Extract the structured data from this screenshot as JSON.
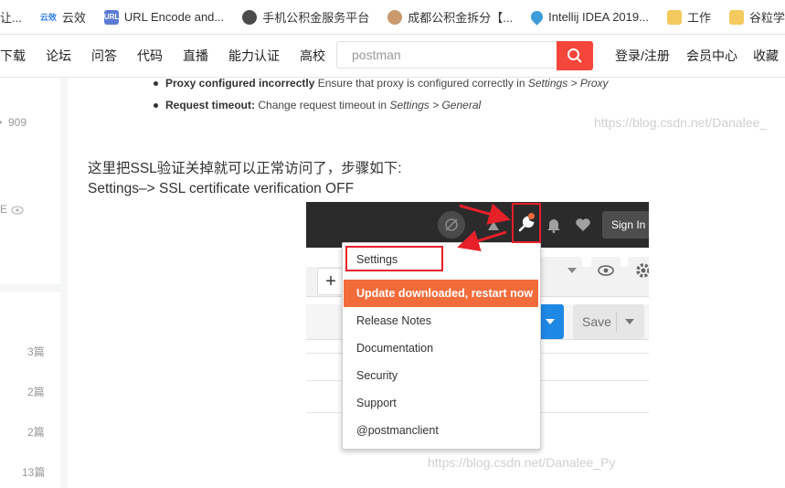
{
  "bookmarks": [
    {
      "label": "让...",
      "icon": "none"
    },
    {
      "label": "云效",
      "icon": "yunxiao-logo-icon",
      "brand_text": "云效"
    },
    {
      "label": "URL Encode and...",
      "icon": "url-icon",
      "badge": "URL"
    },
    {
      "label": "手机公积金服务平台",
      "icon": "globe-icon"
    },
    {
      "label": "成都公积金拆分【...",
      "icon": "avatar-icon"
    },
    {
      "label": "Intellij IDEA 2019...",
      "icon": "map-pin-icon"
    },
    {
      "label": "工作",
      "icon": "folder-icon"
    },
    {
      "label": "谷粒学院",
      "icon": "folder-icon"
    }
  ],
  "nav": {
    "items": [
      "下载",
      "论坛",
      "问答",
      "代码",
      "直播",
      "能力认证",
      "高校"
    ],
    "search_value": "postman",
    "right": [
      "登录/注册",
      "会员中心",
      "收藏"
    ]
  },
  "sidebar": {
    "views": "909",
    "list_counts": [
      "3篇",
      "2篇",
      "2篇",
      "13篇"
    ],
    "partial_char": "E"
  },
  "article": {
    "bullets": [
      {
        "bold": "Proxy configured incorrectly",
        "text": " Ensure that proxy is configured correctly in ",
        "italic": "Settings > Proxy"
      },
      {
        "bold": "Request timeout:",
        "text": " Change request timeout in ",
        "italic": "Settings > General"
      }
    ],
    "para1": "这里把SSL验证关掉就可以正常访问了，步骤如下:",
    "para2": "Settings–> SSL certificate verification OFF",
    "watermark1": "https://blog.csdn.net/Danalee_",
    "watermark2": "https://blog.csdn.net/Danalee_Py"
  },
  "postman": {
    "sign_in": "Sign In",
    "save": "Save",
    "menu": {
      "settings": "Settings",
      "update": "Update downloaded, restart now",
      "items": [
        "Release Notes",
        "Documentation",
        "Security",
        "Support",
        "@postmanclient"
      ]
    },
    "colors": {
      "update_bg": "#f26b3a",
      "annotation": "#e8202a",
      "send": "#1e88e5"
    }
  }
}
